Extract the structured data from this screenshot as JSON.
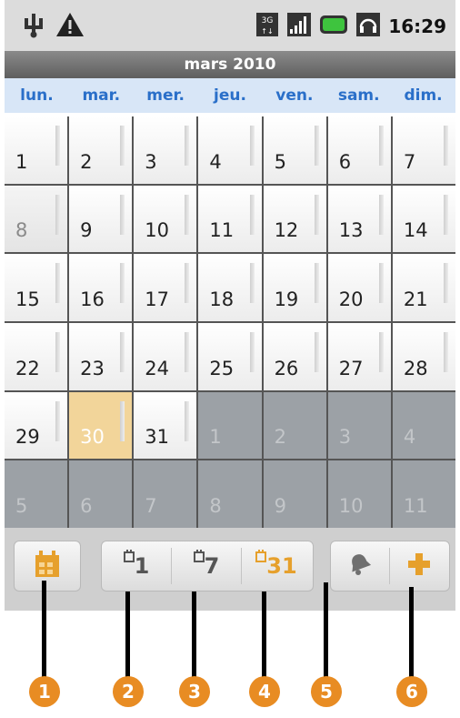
{
  "status_bar": {
    "time": "16:29",
    "left_icons": [
      "usb-icon",
      "warning-icon"
    ],
    "right_icons": [
      "3g-icon",
      "signal-icon",
      "battery-icon",
      "headset-icon"
    ]
  },
  "calendar": {
    "month_title": "mars 2010",
    "weekdays": [
      "lun.",
      "mar.",
      "mer.",
      "jeu.",
      "ven.",
      "sam.",
      "dim."
    ],
    "days": [
      {
        "d": "1",
        "t": "cur"
      },
      {
        "d": "2",
        "t": "cur"
      },
      {
        "d": "3",
        "t": "cur"
      },
      {
        "d": "4",
        "t": "cur"
      },
      {
        "d": "5",
        "t": "cur"
      },
      {
        "d": "6",
        "t": "cur"
      },
      {
        "d": "7",
        "t": "cur"
      },
      {
        "d": "8",
        "t": "prev"
      },
      {
        "d": "9",
        "t": "cur"
      },
      {
        "d": "10",
        "t": "cur"
      },
      {
        "d": "11",
        "t": "cur"
      },
      {
        "d": "12",
        "t": "cur"
      },
      {
        "d": "13",
        "t": "cur"
      },
      {
        "d": "14",
        "t": "cur"
      },
      {
        "d": "15",
        "t": "cur"
      },
      {
        "d": "16",
        "t": "cur"
      },
      {
        "d": "17",
        "t": "cur"
      },
      {
        "d": "18",
        "t": "cur"
      },
      {
        "d": "19",
        "t": "cur"
      },
      {
        "d": "20",
        "t": "cur"
      },
      {
        "d": "21",
        "t": "cur"
      },
      {
        "d": "22",
        "t": "cur"
      },
      {
        "d": "23",
        "t": "cur"
      },
      {
        "d": "24",
        "t": "cur"
      },
      {
        "d": "25",
        "t": "cur"
      },
      {
        "d": "26",
        "t": "cur"
      },
      {
        "d": "27",
        "t": "cur"
      },
      {
        "d": "28",
        "t": "cur"
      },
      {
        "d": "29",
        "t": "cur"
      },
      {
        "d": "30",
        "t": "today"
      },
      {
        "d": "31",
        "t": "cur"
      },
      {
        "d": "1",
        "t": "next"
      },
      {
        "d": "2",
        "t": "next"
      },
      {
        "d": "3",
        "t": "next"
      },
      {
        "d": "4",
        "t": "next"
      },
      {
        "d": "5",
        "t": "next"
      },
      {
        "d": "6",
        "t": "next"
      },
      {
        "d": "7",
        "t": "next"
      },
      {
        "d": "8",
        "t": "next"
      },
      {
        "d": "9",
        "t": "next"
      },
      {
        "d": "10",
        "t": "next"
      },
      {
        "d": "11",
        "t": "next"
      }
    ]
  },
  "toolbar": {
    "day_view_label": "1",
    "week_view_label": "7",
    "month_view_label": "31"
  },
  "callouts": [
    "1",
    "2",
    "3",
    "4",
    "5",
    "6"
  ],
  "colors": {
    "accent_orange": "#e88c23",
    "weekday_blue": "#2a6fc9",
    "today_fill": "#f2d59a"
  }
}
